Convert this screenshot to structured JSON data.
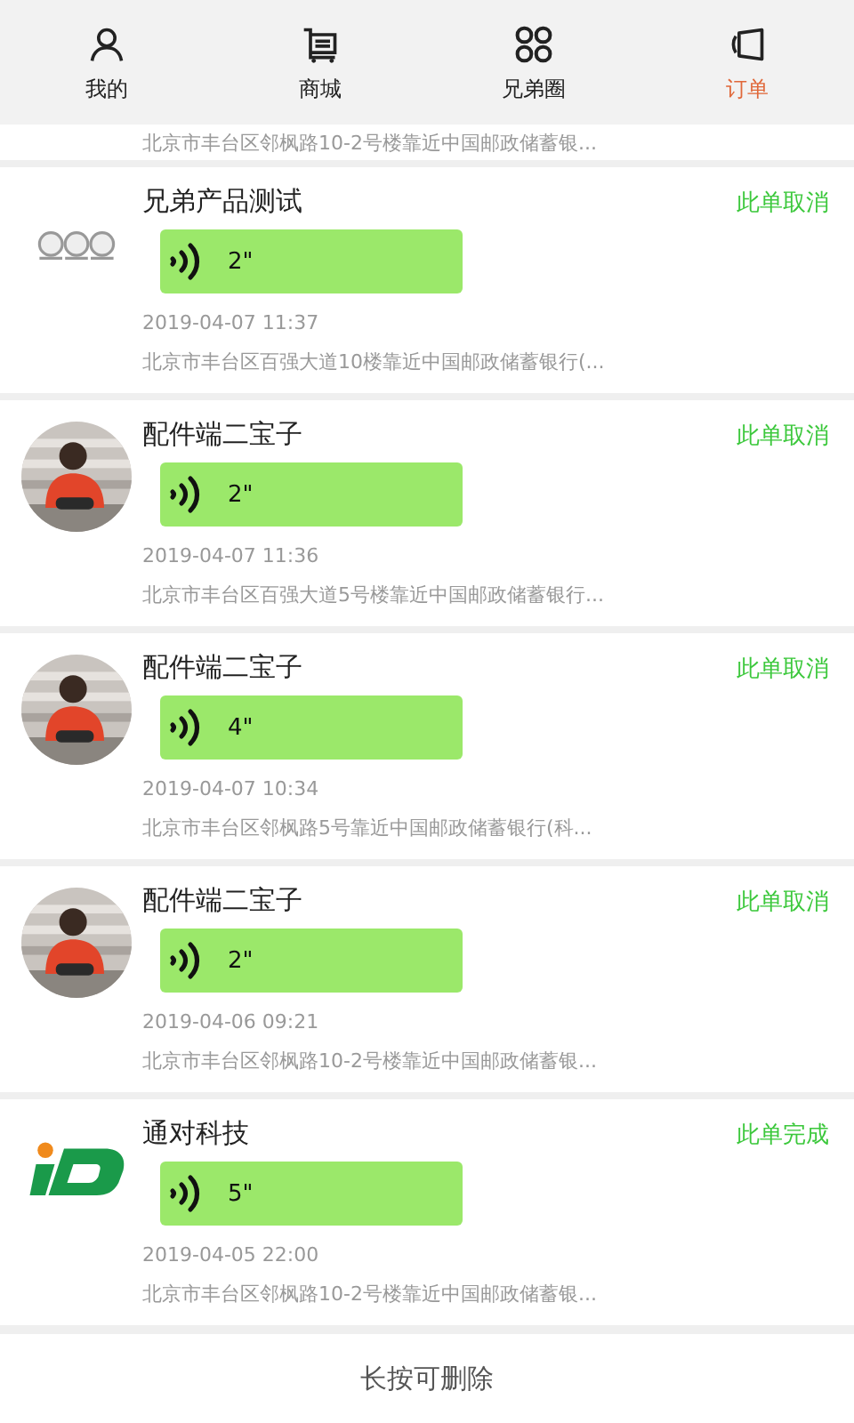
{
  "tabs": [
    {
      "label": "我的",
      "kind": "person",
      "selected": false
    },
    {
      "label": "商城",
      "kind": "cart",
      "selected": false
    },
    {
      "label": "兄弟圈",
      "kind": "grid",
      "selected": false
    },
    {
      "label": "订单",
      "kind": "order",
      "selected": true
    }
  ],
  "partial_address": "北京市丰台区邻枫路10-2号楼靠近中国邮政储蓄银...",
  "orders": [
    {
      "kind": "group",
      "name": "兄弟产品测试",
      "status": "此单取消",
      "duration": "2\"",
      "time": "2019-04-07 11:37",
      "address": "北京市丰台区百强大道10楼靠近中国邮政储蓄银行(..."
    },
    {
      "kind": "picture",
      "name": "配件端二宝子",
      "status": "此单取消",
      "duration": "2\"",
      "time": "2019-04-07 11:36",
      "address": "北京市丰台区百强大道5号楼靠近中国邮政储蓄银行..."
    },
    {
      "kind": "picture",
      "name": "配件端二宝子",
      "status": "此单取消",
      "duration": "4\"",
      "time": "2019-04-07 10:34",
      "address": "北京市丰台区邻枫路5号靠近中国邮政储蓄银行(科..."
    },
    {
      "kind": "picture",
      "name": "配件端二宝子",
      "status": "此单取消",
      "duration": "2\"",
      "time": "2019-04-06 09:21",
      "address": "北京市丰台区邻枫路10-2号楼靠近中国邮政储蓄银..."
    },
    {
      "kind": "logo",
      "name": "通对科技",
      "status": "此单完成",
      "duration": "5\"",
      "time": "2019-04-05 22:00",
      "address": "北京市丰台区邻枫路10-2号楼靠近中国邮政储蓄银..."
    }
  ],
  "footer": "长按可删除"
}
